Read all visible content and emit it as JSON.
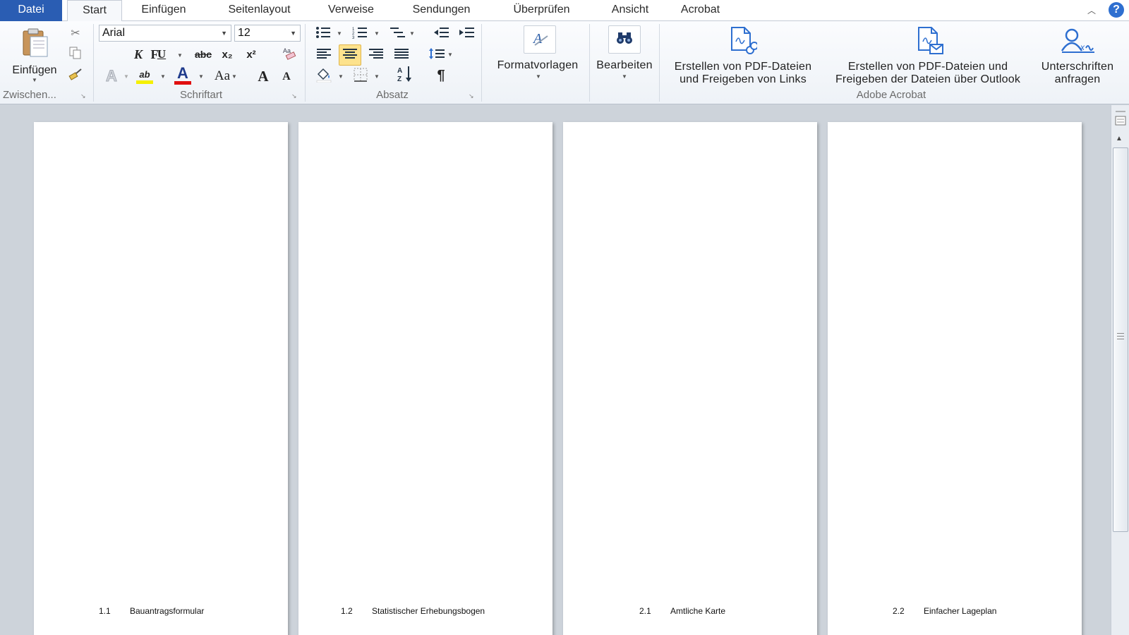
{
  "tabs": {
    "file": "Datei",
    "items": [
      "Start",
      "Einfügen",
      "Seitenlayout",
      "Verweise",
      "Sendungen",
      "Überprüfen",
      "Ansicht",
      "Acrobat"
    ],
    "active": "Start",
    "help": "?"
  },
  "clipboard": {
    "paste_label": "Einfügen",
    "group_label": "Zwischen..."
  },
  "font": {
    "family": "Arial",
    "size": "12",
    "bold": "F",
    "italic": "K",
    "underline": "U",
    "strikethrough": "abc",
    "subscript": "x₂",
    "superscript": "x²",
    "change_case": "Aa",
    "grow": "A",
    "shrink": "A",
    "font_color_glyph": "A",
    "highlight_glyph": "ab",
    "group_label": "Schriftart",
    "font_color": "#e01010",
    "highlight_color": "#f5f000"
  },
  "paragraph": {
    "pilcrow": "¶",
    "sort_glyph": "AZ",
    "group_label": "Absatz",
    "active_alignment": "center"
  },
  "styles": {
    "label": "Formatvorlagen"
  },
  "editing": {
    "label": "Bearbeiten"
  },
  "acrobat": {
    "create_link_line1": "Erstellen von PDF-Dateien",
    "create_link_line2": "und Freigeben von Links",
    "create_outlook_line1": "Erstellen von PDF-Dateien und",
    "create_outlook_line2": "Freigeben der Dateien über Outlook",
    "sign_line1": "Unterschriften",
    "sign_line2": "anfragen",
    "group_label": "Adobe Acrobat",
    "icon_color": "#2e6fd0"
  },
  "pages": [
    {
      "num": "1.1",
      "title": "Bauantragsformular"
    },
    {
      "num": "1.2",
      "title": "Statistischer Erhebungsbogen"
    },
    {
      "num": "2.1",
      "title": "Amtliche Karte"
    },
    {
      "num": "2.2",
      "title": "Einfacher Lageplan"
    }
  ]
}
